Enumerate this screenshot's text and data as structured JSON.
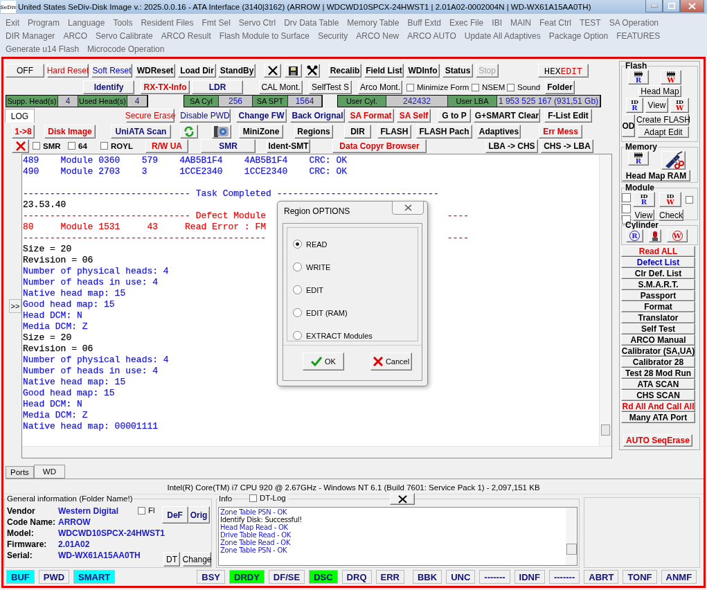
{
  "window": {
    "icon_text": "SeDiv",
    "title": "United States  SeDiv-Disk Image v.: 2025.0.0.16 - ATA Interface (3140|3162)  (ARROW | WDCWD10SPCX-24HWST1 | 2.01A02-0002004N | WD-WX61A15AA0TH)"
  },
  "menu": {
    "lines": [
      [
        "Exit",
        "Program",
        "Language",
        "Tools",
        "Resident Files",
        "Fmt Sel",
        "Servo Ctrl",
        "Drv Data Table",
        "Memory Table",
        "Buff Extd",
        "Exec File",
        "IBI",
        "MAIN",
        "Feat Ctrl",
        "TEST",
        "SA Operation"
      ],
      [
        "DIR Manager",
        "ARCO",
        "Servo Calibrate",
        "ARCO Result",
        "Flash Module to Surface",
        "Security",
        "ARCO New",
        "ARCO AUTO",
        "Update All Adaptives",
        "Package Option",
        "FEATURES"
      ],
      [
        "Generate u14 Flash",
        "Microcode Operation"
      ]
    ]
  },
  "toolbar": {
    "row_1": [
      {
        "kind": "button",
        "text": "OFF",
        "color": "#000000",
        "bold": false
      },
      {
        "kind": "button",
        "text": "Hard Reset",
        "color": "#e00000",
        "bold": false
      },
      {
        "kind": "button",
        "text": "Soft Reset",
        "color": "#0000c8",
        "bold": false
      },
      {
        "kind": "button",
        "text": "WDReset",
        "color": "#000000",
        "bold": true
      },
      {
        "kind": "button",
        "text": "Load Dir",
        "color": "#000000",
        "bold": true
      },
      {
        "kind": "button",
        "text": "StandBy",
        "color": "#000000",
        "bold": true
      },
      {
        "kind": "close"
      },
      {
        "kind": "save"
      },
      {
        "kind": "tools"
      },
      {
        "kind": "button",
        "text": "Recalib",
        "color": "#000000",
        "bold": true
      },
      {
        "kind": "button",
        "text": "Field List",
        "color": "#000000",
        "bold": true
      },
      {
        "kind": "button",
        "text": "WDInfo",
        "color": "#000000",
        "bold": true
      },
      {
        "kind": "button",
        "text": "Status",
        "color": "#000000",
        "bold": true
      },
      {
        "kind": "button",
        "text": "Stop",
        "color": "#a0a0a0",
        "bold": false
      },
      {
        "kind": "hex",
        "text": "HEX",
        "text2": "EDIT"
      }
    ],
    "row_2": [
      {
        "kind": "button",
        "text": "Identify",
        "color": "#10107a",
        "bold": true
      },
      {
        "kind": "button",
        "text": "RX-TX-Info",
        "color": "#e00000",
        "bold": true
      },
      {
        "kind": "button",
        "text": "LDR",
        "color": "#10107a",
        "bold": true
      },
      {
        "kind": "button",
        "text": "CAL Mont.",
        "color": "#000000",
        "bold": false
      },
      {
        "kind": "button",
        "text": "SelfTest S",
        "color": "#000000",
        "bold": false
      },
      {
        "kind": "button",
        "text": "Arco Mont.",
        "color": "#000000",
        "bold": false
      },
      {
        "kind": "check",
        "text": "Minimize Form",
        "checked": false
      },
      {
        "kind": "check",
        "text": "NSEM",
        "checked": false
      },
      {
        "kind": "check",
        "text": "Sound",
        "checked": false
      },
      {
        "kind": "button",
        "text": "Folder",
        "color": "#000000",
        "bold": true
      }
    ],
    "row_3": [
      [
        {
          "label": "Supp. Head(s)",
          "value": "4"
        },
        {
          "label": "Used Head(s)",
          "value": "4"
        }
      ],
      [
        {
          "label": "SA Cyl",
          "value": "256"
        },
        {
          "label": "SA SPT",
          "value": "1564"
        }
      ],
      [
        {
          "label": "User Cyl.",
          "value": "242432"
        },
        {
          "label": "User LBA",
          "value": "1 953 525 167  (931,51 Gb)"
        }
      ]
    ],
    "row_4": [
      {
        "kind": "tab",
        "text": "LOG",
        "selected": true
      },
      {
        "kind": "button",
        "text": "Secure Erase",
        "color": "#e00000",
        "bold": false
      },
      {
        "kind": "button",
        "text": "Disable PWD",
        "color": "#10107a",
        "bold": false
      },
      {
        "kind": "button",
        "text": "Change FW",
        "color": "#10107a",
        "bold": true
      },
      {
        "kind": "button",
        "text": "Back Orignal",
        "color": "#10107a",
        "bold": true
      },
      {
        "kind": "button",
        "text": "SA Format",
        "color": "#e00000",
        "bold": true
      },
      {
        "kind": "button",
        "text": "SA Self",
        "color": "#e00000",
        "bold": true
      },
      {
        "kind": "button",
        "text": "G to P",
        "color": "#000000",
        "bold": true
      },
      {
        "kind": "button",
        "text": "G+SMART Clear",
        "color": "#000000",
        "bold": true
      },
      {
        "kind": "button",
        "text": "F-List Edit",
        "color": "#000000",
        "bold": true
      }
    ],
    "row_5": [
      {
        "kind": "button",
        "text": "1->8",
        "color": "#e00000",
        "bold": true
      },
      {
        "kind": "button",
        "text": "Disk Image",
        "color": "#e00000",
        "bold": true
      },
      {
        "kind": "button",
        "text": "UniATA Scan",
        "color": "#10107a",
        "bold": true
      },
      {
        "kind": "refresh"
      },
      {
        "kind": "camera"
      },
      {
        "kind": "button",
        "text": "MiniZone",
        "color": "#000000",
        "bold": true
      },
      {
        "kind": "button",
        "text": "Regions",
        "color": "#000000",
        "bold": true
      },
      {
        "kind": "button",
        "text": "DIR",
        "color": "#000000",
        "bold": true
      },
      {
        "kind": "button",
        "text": "FLASH",
        "color": "#000000",
        "bold": true
      },
      {
        "kind": "button",
        "text": "FLASH Pach",
        "color": "#000000",
        "bold": true
      },
      {
        "kind": "button",
        "text": "Adaptives",
        "color": "#000000",
        "bold": true
      },
      {
        "kind": "button",
        "text": "Err Mess",
        "color": "#e00000",
        "bold": true
      }
    ],
    "row_6": [
      {
        "kind": "redx"
      },
      {
        "kind": "check",
        "text": "SMR",
        "checked": false
      },
      {
        "kind": "check",
        "text": "64",
        "checked": false
      },
      {
        "kind": "check",
        "text": "ROYL",
        "checked": false
      },
      {
        "kind": "button",
        "text": "R/W UA",
        "color": "#e00000",
        "bold": true
      },
      {
        "kind": "button",
        "text": "SMR",
        "color": "#10107a",
        "bold": true
      },
      {
        "kind": "button",
        "text": "Ident-SMT",
        "color": "#000000",
        "bold": true
      },
      {
        "kind": "button",
        "text": "Data Copyr Browser",
        "color": "#e00000",
        "bold": true
      },
      {
        "kind": "button",
        "text": "LBA -> CHS",
        "color": "#000000",
        "bold": true
      },
      {
        "kind": "button",
        "text": "CHS -> LBA",
        "color": "#000000",
        "bold": true
      }
    ]
  },
  "log": {
    "expand_button": ">>",
    "blocks": [
      [
        {
          "text": "489    Module 0360    579    4AB5B1F4    4AB5B1F4    CRC: OK",
          "color": "#1a1ad0"
        },
        {
          "text": "490    Module 2703    3      1CCE2340    1CCE2340    CRC: OK",
          "color": "#1a1ad0"
        }
      ],
      [
        {
          "text": "------------------------------- Task Completed ------------------------------",
          "color": "#1a1ad0"
        },
        {
          "text": "23.53.40",
          "color": "#000000"
        },
        {
          "text": "------------------------------- Defect Module",
          "tail": "----",
          "color": "#e01010"
        },
        {
          "text": "80     Module 1531     43     Read Error : FM",
          "color": "#e01010"
        },
        {
          "text": "---------------------------------------------",
          "tail": "----",
          "color": "#e01010"
        },
        {
          "text": "Size = 20",
          "color": "#000000"
        },
        {
          "text": "Revision = 06",
          "color": "#000000"
        },
        {
          "text": "Number of physical heads: 4",
          "color": "#1a1ad0"
        },
        {
          "text": "Number of heads in use: 4",
          "color": "#1a1ad0"
        },
        {
          "text": "Native head map: 15",
          "color": "#1a1ad0"
        },
        {
          "text": "Good head map: 15",
          "color": "#1a1ad0"
        },
        {
          "text": "Head DCM: N",
          "color": "#1a1ad0"
        },
        {
          "text": "Media DCM: Z",
          "color": "#1a1ad0"
        },
        {
          "text": "Size = 20",
          "color": "#000000"
        },
        {
          "text": "Revision = 06",
          "color": "#000000"
        },
        {
          "text": "Number of physical heads: 4",
          "color": "#1a1ad0"
        },
        {
          "text": "Number of heads in use: 4",
          "color": "#1a1ad0"
        },
        {
          "text": "Native head map: 15",
          "color": "#1a1ad0"
        },
        {
          "text": "Good head map: 15",
          "color": "#1a1ad0"
        },
        {
          "text": "Head DCM: N",
          "color": "#1a1ad0"
        },
        {
          "text": "Media DCM: Z",
          "color": "#1a1ad0"
        },
        {
          "text": "Native head map: 00001111",
          "color": "#1a1ad0"
        }
      ]
    ]
  },
  "dialog": {
    "title": "Region OPTIONS",
    "options": [
      {
        "label": "READ",
        "selected": true
      },
      {
        "label": "WRITE",
        "selected": false
      },
      {
        "label": "EDIT",
        "selected": false
      },
      {
        "label": "EDIT (RAM)",
        "selected": false
      },
      {
        "label": "EXTRACT Modules",
        "selected": false
      }
    ],
    "ok": "OK",
    "cancel": "Cancel"
  },
  "right_panel": {
    "flash": {
      "title": "Flash",
      "read_chip": "R",
      "write_chip": "W",
      "head_map": "Head Map",
      "id_read": {
        "top": "ID",
        "letter": "R"
      },
      "view": "View",
      "id_write": {
        "top": "ID",
        "letter": "W"
      },
      "od": "OD",
      "create_flash": "Create FLASH",
      "adapt_edit": "Adapt Edit"
    },
    "memory": {
      "title": "Memory",
      "read_chip": "R",
      "head_map_ram": "Head Map RAM"
    },
    "module": {
      "title": "Module",
      "checks": [
        {
          "checked": false
        },
        {
          "checked": false
        },
        {
          "checked": false
        },
        {
          "checked": false
        }
      ],
      "id_read": {
        "top": "ID",
        "letter": "R"
      },
      "id_write": {
        "top": "ID",
        "letter": "W"
      },
      "view": "View",
      "check": "Check"
    },
    "cylinder": {
      "title": "Cylinder",
      "read": "R",
      "write": "W"
    },
    "commands": [
      {
        "text": "Read ALL",
        "color": "#e00000"
      },
      {
        "text": "Defect List",
        "color": "#0000c8"
      },
      {
        "text": "Clr Def. List",
        "color": "#000000"
      },
      {
        "text": "S.M.A.R.T.",
        "color": "#000000"
      },
      {
        "text": "Passport",
        "color": "#000000"
      },
      {
        "text": "Format",
        "color": "#000000"
      },
      {
        "text": "Translator",
        "color": "#000000"
      },
      {
        "text": "Self Test",
        "color": "#000000"
      },
      {
        "text": "ARCO Manual",
        "color": "#000000"
      },
      {
        "text": "Calibrator (SA,UA)",
        "color": "#000000"
      },
      {
        "text": "Calibrator 28",
        "color": "#000000"
      },
      {
        "text": "Test 28 Mod Run",
        "color": "#000000"
      },
      {
        "text": "ATA SCAN",
        "color": "#000000"
      },
      {
        "text": "CHS SCAN",
        "color": "#000000"
      },
      {
        "text": "Rd All And Call All",
        "color": "#e00000"
      },
      {
        "text": "Many ATA Port",
        "color": "#000000"
      }
    ],
    "auto_seq_erase": {
      "text": "AUTO SeqErase",
      "color": "#e00000"
    }
  },
  "bottom_tabs": [
    {
      "label": "Ports",
      "selected": false
    },
    {
      "label": "WD",
      "selected": true
    }
  ],
  "system_info": "Intel(R) Core(TM) i7 CPU 920  @ 2.67GHz - Windows NT 6.1 (Build 7601: Service Pack 1) -  2,097,151 KB",
  "general_info": {
    "title": "General information (Folder Name!)",
    "fl": {
      "label": "Fl",
      "checked": false
    },
    "def": "DeF",
    "orig": "Orig",
    "fields": [
      {
        "label": "Vendor",
        "value": "Western Digital"
      },
      {
        "label": "Code Name:",
        "value": "ARROW"
      },
      {
        "label": "Model:",
        "value": "WDCWD10SPCX-24HWST1"
      },
      {
        "label": "Firmware:",
        "value": "2.01A02"
      },
      {
        "label": "Serial:",
        "value": "WD-WX61A15AA0TH"
      }
    ],
    "dt": "DT",
    "change": "Change"
  },
  "info": {
    "title": "Info",
    "dt_log": {
      "label": "DT-Log",
      "checked": false
    },
    "lines": [
      {
        "text": "Zone Table PSN - OK",
        "color": "#1a1ad0"
      },
      {
        "text": "Identify Disk: Successful!",
        "color": "#000000"
      },
      {
        "text": "Head Map Read - OK",
        "color": "#1a1ad0"
      },
      {
        "text": "Drive Table Read - OK",
        "color": "#1a1ad0"
      },
      {
        "text": "Zone Table Read - OK",
        "color": "#1a1ad0"
      },
      {
        "text": "Zone Table PSN - OK",
        "color": "#1a1ad0"
      }
    ]
  },
  "status_bar": {
    "left": [
      {
        "text": "BUF",
        "color": "#00ffff"
      },
      {
        "text": "PWD",
        "color": "#f0f0f0"
      },
      {
        "text": "SMART",
        "color": "#00ffff"
      }
    ],
    "right": [
      {
        "text": "BSY",
        "color": "#f0f0f0"
      },
      {
        "text": "DRDY",
        "color": "#00ff00"
      },
      {
        "text": "DF/SE",
        "color": "#f0f0f0"
      },
      {
        "text": "DSC",
        "color": "#00ff00"
      },
      {
        "text": "DRQ",
        "color": "#f0f0f0"
      },
      {
        "text": "ERR",
        "color": "#f0f0f0"
      },
      {
        "text": "BBK",
        "color": "#f0f0f0"
      },
      {
        "text": "UNC",
        "color": "#f0f0f0"
      },
      {
        "text": "-------",
        "color": "#f0f0f0"
      },
      {
        "text": "IDNF",
        "color": "#f0f0f0"
      },
      {
        "text": "-------",
        "color": "#f0f0f0"
      },
      {
        "text": "ABRT",
        "color": "#f0f0f0"
      },
      {
        "text": "TONF",
        "color": "#f0f0f0"
      },
      {
        "text": "ANMF",
        "color": "#f0f0f0"
      }
    ]
  }
}
